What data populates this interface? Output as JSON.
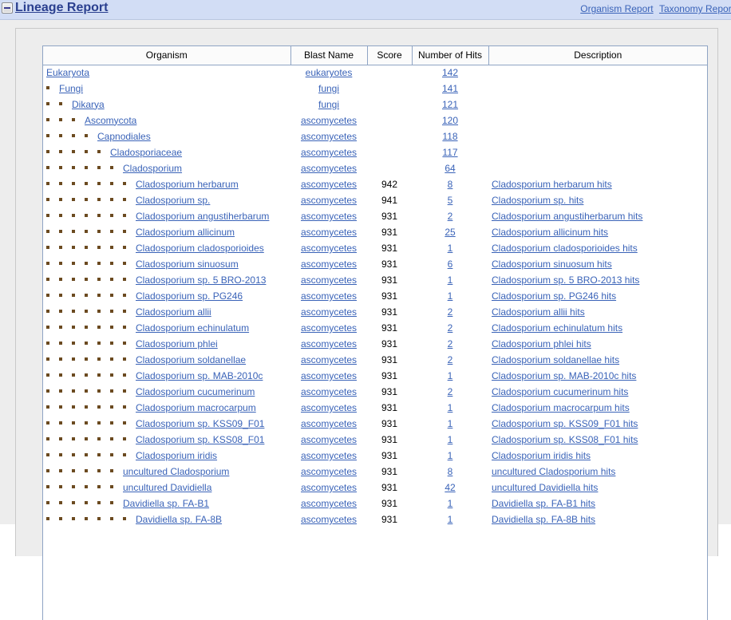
{
  "header": {
    "toggle_icon": "minus-icon",
    "title": "Lineage Report",
    "links": [
      {
        "label": "Organism Report"
      },
      {
        "label": "Taxonomy Report"
      }
    ]
  },
  "table": {
    "columns": [
      "Organism",
      "Blast Name",
      "Score",
      "Number of Hits",
      "Description"
    ],
    "rows": [
      {
        "depth": 0,
        "organism": "Eukaryota",
        "blast": "eukaryotes",
        "score": "",
        "hits": "142",
        "desc": ""
      },
      {
        "depth": 1,
        "organism": "Fungi",
        "blast": "fungi",
        "score": "",
        "hits": "141",
        "desc": ""
      },
      {
        "depth": 2,
        "organism": "Dikarya",
        "blast": "fungi",
        "score": "",
        "hits": "121",
        "desc": ""
      },
      {
        "depth": 3,
        "organism": "Ascomycota",
        "blast": "ascomycetes",
        "score": "",
        "hits": "120",
        "desc": ""
      },
      {
        "depth": 4,
        "organism": "Capnodiales",
        "blast": "ascomycetes",
        "score": "",
        "hits": "118",
        "desc": ""
      },
      {
        "depth": 5,
        "organism": "Cladosporiaceae",
        "blast": "ascomycetes",
        "score": "",
        "hits": "117",
        "desc": ""
      },
      {
        "depth": 6,
        "organism": "Cladosporium",
        "blast": "ascomycetes",
        "score": "",
        "hits": "64",
        "desc": ""
      },
      {
        "depth": 7,
        "organism": "Cladosporium herbarum",
        "blast": "ascomycetes",
        "score": "942",
        "hits": "8",
        "desc": "Cladosporium herbarum hits"
      },
      {
        "depth": 7,
        "organism": "Cladosporium sp.",
        "blast": "ascomycetes",
        "score": "941",
        "hits": "5",
        "desc": "Cladosporium sp. hits"
      },
      {
        "depth": 7,
        "organism": "Cladosporium angustiherbarum",
        "blast": "ascomycetes",
        "score": "931",
        "hits": "2",
        "desc": "Cladosporium angustiherbarum hits"
      },
      {
        "depth": 7,
        "organism": "Cladosporium allicinum",
        "blast": "ascomycetes",
        "score": "931",
        "hits": "25",
        "desc": "Cladosporium allicinum hits"
      },
      {
        "depth": 7,
        "organism": "Cladosporium cladosporioides",
        "blast": "ascomycetes",
        "score": "931",
        "hits": "1",
        "desc": "Cladosporium cladosporioides hits"
      },
      {
        "depth": 7,
        "organism": "Cladosporium sinuosum",
        "blast": "ascomycetes",
        "score": "931",
        "hits": "6",
        "desc": "Cladosporium sinuosum hits"
      },
      {
        "depth": 7,
        "organism": "Cladosporium sp. 5 BRO-2013",
        "blast": "ascomycetes",
        "score": "931",
        "hits": "1",
        "desc": "Cladosporium sp. 5 BRO-2013 hits"
      },
      {
        "depth": 7,
        "organism": "Cladosporium sp. PG246",
        "blast": "ascomycetes",
        "score": "931",
        "hits": "1",
        "desc": "Cladosporium sp. PG246 hits"
      },
      {
        "depth": 7,
        "organism": "Cladosporium allii",
        "blast": "ascomycetes",
        "score": "931",
        "hits": "2",
        "desc": "Cladosporium allii hits"
      },
      {
        "depth": 7,
        "organism": "Cladosporium echinulatum",
        "blast": "ascomycetes",
        "score": "931",
        "hits": "2",
        "desc": "Cladosporium echinulatum hits"
      },
      {
        "depth": 7,
        "organism": "Cladosporium phlei",
        "blast": "ascomycetes",
        "score": "931",
        "hits": "2",
        "desc": "Cladosporium phlei hits"
      },
      {
        "depth": 7,
        "organism": "Cladosporium soldanellae",
        "blast": "ascomycetes",
        "score": "931",
        "hits": "2",
        "desc": "Cladosporium soldanellae hits"
      },
      {
        "depth": 7,
        "organism": "Cladosporium sp. MAB-2010c",
        "blast": "ascomycetes",
        "score": "931",
        "hits": "1",
        "desc": "Cladosporium sp. MAB-2010c hits"
      },
      {
        "depth": 7,
        "organism": "Cladosporium cucumerinum",
        "blast": "ascomycetes",
        "score": "931",
        "hits": "2",
        "desc": "Cladosporium cucumerinum hits"
      },
      {
        "depth": 7,
        "organism": "Cladosporium macrocarpum",
        "blast": "ascomycetes",
        "score": "931",
        "hits": "1",
        "desc": "Cladosporium macrocarpum hits"
      },
      {
        "depth": 7,
        "organism": "Cladosporium sp. KSS09_F01",
        "blast": "ascomycetes",
        "score": "931",
        "hits": "1",
        "desc": "Cladosporium sp. KSS09_F01 hits"
      },
      {
        "depth": 7,
        "organism": "Cladosporium sp. KSS08_F01",
        "blast": "ascomycetes",
        "score": "931",
        "hits": "1",
        "desc": "Cladosporium sp. KSS08_F01 hits"
      },
      {
        "depth": 7,
        "organism": "Cladosporium iridis",
        "blast": "ascomycetes",
        "score": "931",
        "hits": "1",
        "desc": "Cladosporium iridis hits"
      },
      {
        "depth": 6,
        "organism": "uncultured Cladosporium",
        "blast": "ascomycetes",
        "score": "931",
        "hits": "8",
        "desc": "uncultured Cladosporium hits"
      },
      {
        "depth": 6,
        "organism": "uncultured Davidiella",
        "blast": "ascomycetes",
        "score": "931",
        "hits": "42",
        "desc": "uncultured Davidiella hits"
      },
      {
        "depth": 6,
        "organism": "Davidiella sp. FA-B1",
        "blast": "ascomycetes",
        "score": "931",
        "hits": "1",
        "desc": "Davidiella sp. FA-B1 hits"
      },
      {
        "depth": 7,
        "organism": "Davidiella sp. FA-8B",
        "blast": "ascomycetes",
        "score": "931",
        "hits": "1",
        "desc": "Davidiella sp. FA-8B hits"
      }
    ]
  },
  "colors": {
    "titlebar": "#d2ddf5",
    "link": "#3a63b8",
    "title_text": "#2a3f8f",
    "page_bg": "#ededed",
    "table_border": "#8fa4c4"
  }
}
